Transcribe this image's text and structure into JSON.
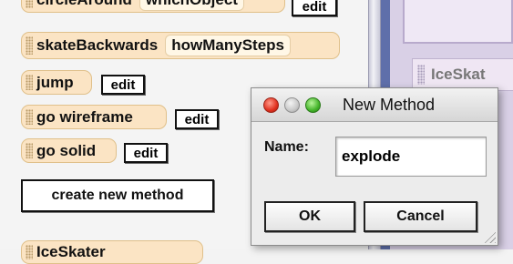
{
  "methods_pane": {
    "partial_tile_label": "circleAround",
    "partial_tile_param": "whichObject",
    "partial_edit_label": "edit",
    "skate_backwards": {
      "label": "skateBackwards",
      "param": "howManySteps"
    },
    "jump": {
      "label": "jump",
      "edit_label": "edit"
    },
    "go_wireframe": {
      "label": "go wireframe",
      "edit_label": "edit"
    },
    "go_solid": {
      "label": "go solid",
      "edit_label": "edit"
    },
    "create_new_method_label": "create new method",
    "partial_bottom_label": "IceSkater"
  },
  "right_pane": {
    "tile_label": "IceSkat"
  },
  "dialog": {
    "title": "New Method",
    "name_label": "Name:",
    "name_value": "explode",
    "ok_label": "OK",
    "cancel_label": "Cancel"
  },
  "colors": {
    "tile_fill": "#fbe4c4",
    "panel_frame": "#5f6faa",
    "close_light": "#e0301e",
    "zoom_light": "#44b42a"
  }
}
